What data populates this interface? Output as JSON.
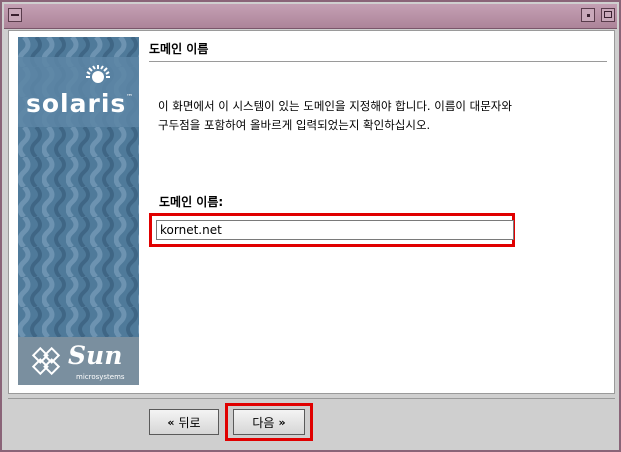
{
  "window": {
    "title": ""
  },
  "banner": {
    "product_logo": "solaris",
    "vendor_logo": "Sun",
    "vendor_sub": "microsystems"
  },
  "page": {
    "title": "도메인 이름",
    "description_line1": "이 화면에서 이 시스템이 있는 도메인을 지정해야 합니다. 이름이 대문자와",
    "description_line2": "구두점을 포함하여 올바르게 입력되었는지 확인하십시오.",
    "field_label": "도메인 이름:",
    "domain_value": "kornet.net"
  },
  "buttons": {
    "back_label": "뒤로",
    "next_label": "다음",
    "back_icon": "double-chevron-left-icon",
    "next_icon": "double-chevron-right-icon"
  },
  "colors": {
    "highlight": "#e00000",
    "banner": "#4f7a9a",
    "titlebar": "#b58ea3"
  }
}
